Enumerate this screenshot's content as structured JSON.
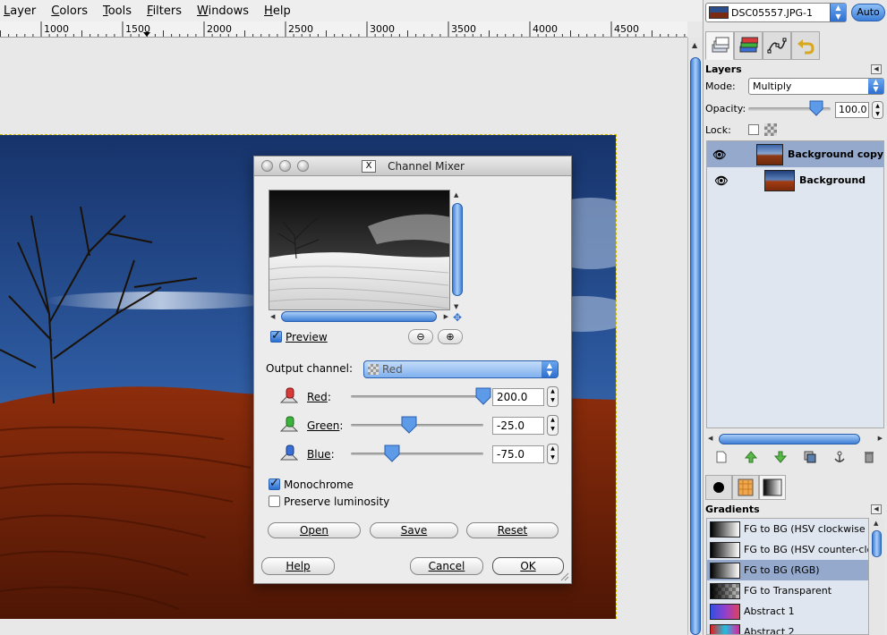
{
  "menubar": {
    "items": [
      "Layer",
      "Colors",
      "Tools",
      "Filters",
      "Windows",
      "Help"
    ]
  },
  "ruler": {
    "labels": [
      "1000",
      "1500",
      "2000",
      "2500",
      "3000",
      "3500",
      "4000",
      "4500"
    ]
  },
  "dock": {
    "image_name": "DSC05557.JPG-1",
    "auto_label": "Auto",
    "tabs": [
      "layers-icon",
      "channels-icon",
      "paths-icon",
      "undo-icon"
    ],
    "layers": {
      "title": "Layers",
      "mode_label": "Mode:",
      "mode_value": "Multiply",
      "opacity_label": "Opacity:",
      "opacity_value": "100.0",
      "opacity_level": 1.0,
      "lock_label": "Lock:",
      "items": [
        {
          "name": "Background copy",
          "visible": true,
          "selected": true
        },
        {
          "name": "Background",
          "visible": true,
          "selected": false
        }
      ],
      "actions": [
        "new-layer-icon",
        "raise-layer-icon",
        "lower-layer-icon",
        "duplicate-layer-icon",
        "anchor-icon",
        "delete-icon"
      ]
    },
    "lower_tabs": [
      "brushes-icon",
      "patterns-icon",
      "gradients-icon"
    ],
    "gradients": {
      "title": "Gradients",
      "items": [
        {
          "name": "FG to BG (HSV clockwise hue)",
          "selected": false
        },
        {
          "name": "FG to BG (HSV counter-clockwise)",
          "selected": false
        },
        {
          "name": "FG to BG (RGB)",
          "selected": true
        },
        {
          "name": "FG to Transparent",
          "selected": false
        },
        {
          "name": "Abstract 1",
          "selected": false
        },
        {
          "name": "Abstract 2",
          "selected": false
        }
      ]
    }
  },
  "dialog": {
    "title": "Channel Mixer",
    "preview_label": "Preview",
    "preview_checked": true,
    "output_channel_label": "Output channel:",
    "output_channel_value": "Red",
    "channels": [
      {
        "name": "Red",
        "value": "200.0",
        "slider": 200,
        "color": "#d83a3a"
      },
      {
        "name": "Green",
        "value": "-25.0",
        "slider": -25,
        "color": "#3cb43c"
      },
      {
        "name": "Blue",
        "value": "-75.0",
        "slider": -75,
        "color": "#3a6fd8"
      }
    ],
    "slider_range": [
      -200,
      200
    ],
    "monochrome_label": "Monochrome",
    "monochrome_checked": true,
    "preserve_label": "Preserve luminosity",
    "preserve_checked": false,
    "buttons": {
      "open": "Open",
      "save": "Save",
      "reset": "Reset",
      "help": "Help",
      "cancel": "Cancel",
      "ok": "OK"
    }
  }
}
